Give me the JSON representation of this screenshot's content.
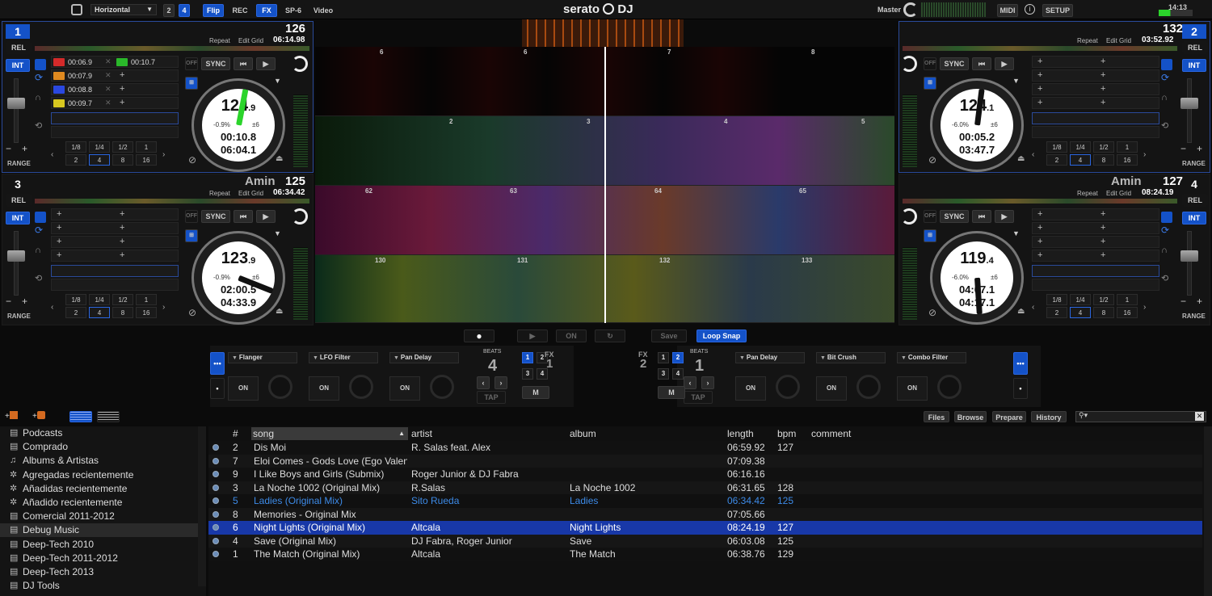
{
  "topbar": {
    "layout_select": "Horizontal",
    "deck_count_2": "2",
    "deck_count_4": "4",
    "flip": "Flip",
    "rec": "REC",
    "fx": "FX",
    "sp6": "SP-6",
    "video": "Video",
    "logo": "serato",
    "logo_dj": "DJ",
    "master": "Master",
    "midi": "MIDI",
    "setup": "SETUP",
    "clock": "14:13"
  },
  "decks": [
    {
      "num": "1",
      "mode": "REL",
      "int": "INT",
      "bpm": "126",
      "key": "",
      "elapsed_total": "06:14.98",
      "repeat": "Repeat",
      "editgrid": "Edit Grid",
      "platter_bpm": "124",
      "platter_bpm_dec": ".9",
      "pitch": "-0.9%",
      "range": "±6",
      "time1": "00:10.8",
      "time2": "06:04.1",
      "sync": "SYNC",
      "off": "OFF",
      "range_label": "RANGE",
      "cues": [
        {
          "time": "00:06.9",
          "color": "#d42a2a"
        },
        {
          "time": "00:10.7",
          "color": "#2ab82a"
        },
        {
          "time": "00:07.9",
          "color": "#e08a20"
        },
        {
          "time": "00:08.8",
          "color": "#2a48e0"
        },
        {
          "time": "00:09.7",
          "color": "#d8c820"
        }
      ],
      "needle_color": "#2bd42b",
      "needle_fraction": 0.03
    },
    {
      "num": "2",
      "mode": "REL",
      "int": "INT",
      "bpm": "132",
      "key": "",
      "elapsed_total": "03:52.92",
      "repeat": "Repeat",
      "editgrid": "Edit Grid",
      "platter_bpm": "124",
      "platter_bpm_dec": ".1",
      "pitch": "-6.0%",
      "range": "±6",
      "time1": "00:05.2",
      "time2": "03:47.7",
      "sync": "SYNC",
      "off": "OFF",
      "range_label": "RANGE",
      "cues": [],
      "needle_color": "#111",
      "needle_fraction": 0.02
    },
    {
      "num": "3",
      "mode": "REL",
      "int": "INT",
      "bpm": "125",
      "key": "Amin",
      "elapsed_total": "06:34.42",
      "repeat": "Repeat",
      "editgrid": "Edit Grid",
      "platter_bpm": "123",
      "platter_bpm_dec": ".9",
      "pitch": "-0.9%",
      "range": "±6",
      "time1": "02:00.5",
      "time2": "04:33.9",
      "sync": "SYNC",
      "off": "OFF",
      "range_label": "RANGE",
      "cues": [],
      "needle_color": "#111",
      "needle_fraction": 0.31
    },
    {
      "num": "4",
      "mode": "REL",
      "int": "INT",
      "bpm": "127",
      "key": "Amin",
      "elapsed_total": "08:24.19",
      "repeat": "Repeat",
      "editgrid": "Edit Grid",
      "platter_bpm": "119",
      "platter_bpm_dec": ".4",
      "pitch": "-6.0%",
      "range": "±6",
      "time1": "04:07.1",
      "time2": "04:17.1",
      "sync": "SYNC",
      "off": "OFF",
      "range_label": "RANGE",
      "cues": [],
      "needle_color": "#111",
      "needle_fraction": 0.49
    }
  ],
  "loop_grid": {
    "row1": [
      "1/8",
      "1/4",
      "1/2",
      "1"
    ],
    "row2": [
      "2",
      "4",
      "8",
      "16"
    ]
  },
  "wave_beats": {
    "row1": [
      "6",
      "6",
      "7",
      "8"
    ],
    "row2": [
      "2",
      "3",
      "4",
      "5"
    ],
    "row3": [
      "62",
      "63",
      "64",
      "65"
    ],
    "row4": [
      "130",
      "131",
      "132",
      "133"
    ]
  },
  "transport": {
    "on": "ON",
    "save": "Save",
    "loop_snap": "Loop Snap"
  },
  "fx1": {
    "label": "FX",
    "unit": "1",
    "slots": [
      "Flanger",
      "LFO Filter",
      "Pan Delay"
    ],
    "beats_label": "BEATS",
    "beats": "4",
    "tap": "TAP",
    "on": "ON",
    "m": "M",
    "grid": [
      "1",
      "2",
      "3",
      "4"
    ]
  },
  "fx2": {
    "label": "FX",
    "unit": "2",
    "slots": [
      "Pan Delay",
      "Bit Crush",
      "Combo Filter"
    ],
    "beats_label": "BEATS",
    "beats": "1",
    "tap": "TAP",
    "on": "ON",
    "m": "M",
    "grid": [
      "1",
      "2",
      "3",
      "4"
    ]
  },
  "library_tabs": {
    "files": "Files",
    "browse": "Browse",
    "prepare": "Prepare",
    "history": "History"
  },
  "crates": [
    {
      "label": "Podcasts",
      "icon": "crate-icon"
    },
    {
      "label": "Comprado",
      "icon": "crate-icon"
    },
    {
      "label": "Albums & Artistas",
      "icon": "music-note-icon"
    },
    {
      "label": "Agregadas recientemente",
      "icon": "gear-icon"
    },
    {
      "label": "Añadidas recientemente",
      "icon": "gear-icon"
    },
    {
      "label": "Añadido recientemente",
      "icon": "gear-icon"
    },
    {
      "label": "Comercial 2011-2012",
      "icon": "crate-icon"
    },
    {
      "label": "Debug Music",
      "icon": "crate-icon"
    },
    {
      "label": "Deep-Tech 2010",
      "icon": "crate-icon"
    },
    {
      "label": "Deep-Tech 2011-2012",
      "icon": "crate-icon"
    },
    {
      "label": "Deep-Tech 2013",
      "icon": "crate-icon"
    },
    {
      "label": "DJ Tools",
      "icon": "crate-icon"
    }
  ],
  "columns": {
    "num": "#",
    "song": "song",
    "artist": "artist",
    "album": "album",
    "length": "length",
    "bpm": "bpm",
    "comment": "comment"
  },
  "tracks": [
    {
      "num": "2",
      "song": "Dis Moi",
      "artist": "R. Salas feat. Alex",
      "album": "",
      "length": "06:59.92",
      "bpm": "127",
      "state": "normal"
    },
    {
      "num": "7",
      "song": "Eloi Comes - Gods Love (Ego Valente Remix)",
      "artist": "",
      "album": "",
      "length": "07:09.38",
      "bpm": "",
      "state": "normal"
    },
    {
      "num": "9",
      "song": "I Like Boys and Girls (Submix)",
      "artist": "Roger Junior & DJ Fabra",
      "album": "",
      "length": "06:16.16",
      "bpm": "",
      "state": "normal"
    },
    {
      "num": "3",
      "song": "La Noche 1002 (Original Mix)",
      "artist": "R.Salas",
      "album": "La Noche 1002",
      "length": "06:31.65",
      "bpm": "128",
      "state": "normal"
    },
    {
      "num": "5",
      "song": "Ladies (Original Mix)",
      "artist": "Sito Rueda",
      "album": "Ladies",
      "length": "06:34.42",
      "bpm": "125",
      "state": "played"
    },
    {
      "num": "8",
      "song": "Memories - Original Mix",
      "artist": "",
      "album": "",
      "length": "07:05.66",
      "bpm": "",
      "state": "normal"
    },
    {
      "num": "6",
      "song": "Night Lights (Original Mix)",
      "artist": "Altcala",
      "album": "Night Lights",
      "length": "08:24.19",
      "bpm": "127",
      "state": "selected"
    },
    {
      "num": "4",
      "song": "Save (Original Mix)",
      "artist": "DJ Fabra, Roger Junior",
      "album": "Save",
      "length": "06:03.08",
      "bpm": "125",
      "state": "normal"
    },
    {
      "num": "1",
      "song": "The Match (Original Mix)",
      "artist": "Altcala",
      "album": "The Match",
      "length": "06:38.76",
      "bpm": "129",
      "state": "normal"
    }
  ]
}
